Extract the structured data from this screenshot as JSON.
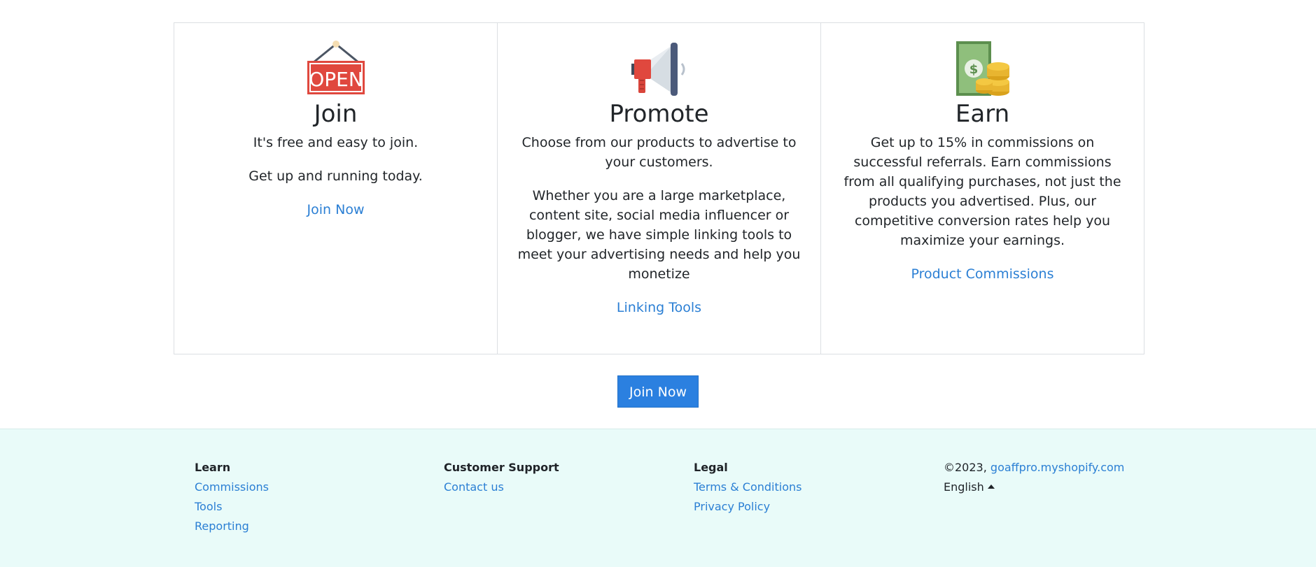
{
  "cards": [
    {
      "icon": "open-sign-icon",
      "title": "Join",
      "paragraphs": [
        "It's free and easy to join.",
        "Get up and running today."
      ],
      "link": "Join Now"
    },
    {
      "icon": "megaphone-icon",
      "title": "Promote",
      "paragraphs": [
        "Choose from our products to advertise to your customers.",
        "Whether you are a large marketplace, content site, social media influencer or blogger, we have simple linking tools to meet your advertising needs and help you monetize"
      ],
      "link": "Linking Tools"
    },
    {
      "icon": "money-coins-icon",
      "title": "Earn",
      "paragraphs": [
        "Get up to 15% in commissions on successful referrals. Earn commissions from all qualifying purchases, not just the products you advertised. Plus, our competitive conversion rates help you maximize your earnings."
      ],
      "link": "Product Commissions"
    }
  ],
  "open_sign_text": "OPEN",
  "cta": {
    "label": "Join Now"
  },
  "footer": {
    "learn": {
      "heading": "Learn",
      "links": [
        "Commissions",
        "Tools",
        "Reporting"
      ]
    },
    "support": {
      "heading": "Customer Support",
      "links": [
        "Contact us"
      ]
    },
    "legal": {
      "heading": "Legal",
      "links": [
        "Terms & Conditions",
        "Privacy Policy"
      ]
    },
    "copyright_prefix": "©2023,",
    "site_link": "goaffpro.myshopify.com",
    "language": "English"
  },
  "colors": {
    "link": "#2b7fd4",
    "button": "#2b80e0",
    "footer_bg": "#e9fbf9",
    "open_sign_red": "#e0483e"
  }
}
